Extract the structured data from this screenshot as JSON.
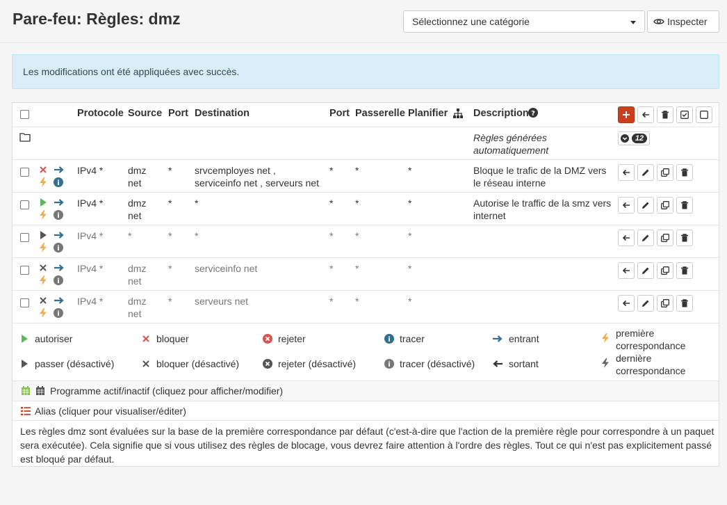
{
  "header": {
    "title": "Pare-feu: Règles: dmz",
    "category_placeholder": "Sélectionnez une catégorie",
    "inspect_label": "Inspecter"
  },
  "alert": {
    "message": "Les modifications ont été appliquées avec succès."
  },
  "table": {
    "columns": {
      "protocol": "Protocole",
      "source": "Source",
      "port": "Port",
      "destination": "Destination",
      "dest_port": "Port",
      "gateway": "Passerelle",
      "schedule": "Planifier",
      "description": "Description"
    },
    "group": {
      "description_line1": "Règles générées",
      "description_line2": "automatiquement",
      "count": "12"
    },
    "rows": [
      {
        "protocol": "IPv4 *",
        "source_l1": "dmz",
        "source_l2": "net",
        "port": "*",
        "dest_l1": "srvcemployes net ,",
        "dest_l2": "serviceinfo net , serveurs net",
        "dest_port": "*",
        "gateway": "*",
        "schedule": "*",
        "desc_l1": "Bloque le trafic de la DMZ vers",
        "desc_l2": "le réseau interne"
      },
      {
        "protocol": "IPv4 *",
        "source_l1": "dmz",
        "source_l2": "net",
        "port": "*",
        "dest_l1": "*",
        "dest_l2": "",
        "dest_port": "*",
        "gateway": "*",
        "schedule": "*",
        "desc_l1": "Autorise le traffic de la smz vers",
        "desc_l2": "internet"
      },
      {
        "protocol": "IPv4 *",
        "source_l1": "*",
        "source_l2": "",
        "port": "*",
        "dest_l1": "*",
        "dest_l2": "",
        "dest_port": "*",
        "gateway": "*",
        "schedule": "*",
        "desc_l1": "",
        "desc_l2": ""
      },
      {
        "protocol": "IPv4 *",
        "source_l1": "dmz",
        "source_l2": "net",
        "port": "*",
        "dest_l1": "serviceinfo net",
        "dest_l2": "",
        "dest_port": "*",
        "gateway": "*",
        "schedule": "*",
        "desc_l1": "",
        "desc_l2": ""
      },
      {
        "protocol": "IPv4 *",
        "source_l1": "dmz",
        "source_l2": "net",
        "port": "*",
        "dest_l1": "serveurs net",
        "dest_l2": "",
        "dest_port": "*",
        "gateway": "*",
        "schedule": "*",
        "desc_l1": "",
        "desc_l2": ""
      }
    ]
  },
  "legend": {
    "pass": "autoriser",
    "block": "bloquer",
    "reject": "rejeter",
    "log": "tracer",
    "in": "entrant",
    "first_l1": "première",
    "first_l2": "correspondance",
    "pass_disabled": "passer (désactivé)",
    "block_disabled": "bloquer (désactivé)",
    "reject_disabled": "rejeter (désactivé)",
    "log_disabled": "tracer (désactivé)",
    "out": "sortant",
    "last_l1": "dernière",
    "last_l2": "correspondance"
  },
  "schedule_note": "Programme actif/inactif (cliquez pour afficher/modifier)",
  "alias_note": "Alias (cliquer pour visualiser/éditer)",
  "footer_note": "Les règles dmz sont évaluées sur la base de la première correspondance par défaut (c'est-à-dire que l'action de la première règle pour correspondre à un paquet sera exécutée). Cela signifie que si vous utilisez des règles de blocage, vous devrez faire attention à l'ordre des règles. Tout ce qui n'est pas explicitement passé est bloqué par défaut.",
  "colors": {
    "accent": "#c9401f",
    "pass": "#5cb85c",
    "block": "#d9534f",
    "info": "#31708f",
    "lightning": "#f0ad4e"
  }
}
